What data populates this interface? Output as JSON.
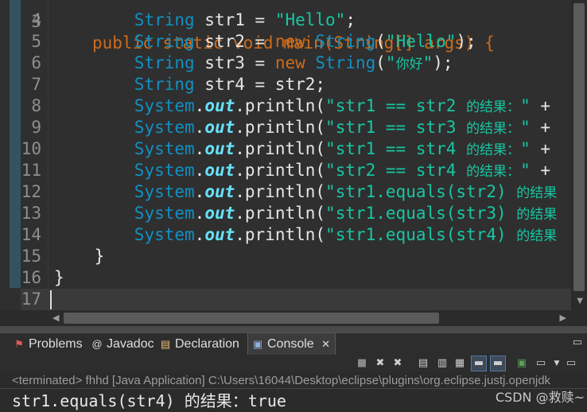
{
  "editor": {
    "header_line": {
      "num": "3",
      "text": "public static void main(String[] args) {"
    },
    "lines": [
      {
        "num": "4",
        "t": "String",
        "v": " str1 = ",
        "s": "\"Hello\"",
        "e": ";"
      },
      {
        "num": "5",
        "t": "String",
        "v": " str2 = ",
        "k": "new",
        "t2": " String",
        "p": "(",
        "s": "\"Hello\"",
        "e": ");"
      },
      {
        "num": "6",
        "t": "String",
        "v": " str3 = ",
        "k": "new",
        "t2": " String",
        "p": "(",
        "s": "\"",
        "cjk": "你好",
        "s2": "\"",
        "e": ");"
      },
      {
        "num": "7",
        "t": "String",
        "v": " str4 = str2;"
      },
      {
        "num": "8",
        "sys": "System",
        "dot": ".",
        "out": "out",
        "pr": ".println(",
        "s": "\"str1 == str2 ",
        "cjk": "的结果：",
        "s2": "\"",
        "e": " +"
      },
      {
        "num": "9",
        "sys": "System",
        "dot": ".",
        "out": "out",
        "pr": ".println(",
        "s": "\"str1 == str3 ",
        "cjk": "的结果：",
        "s2": "\"",
        "e": " +"
      },
      {
        "num": "10",
        "sys": "System",
        "dot": ".",
        "out": "out",
        "pr": ".println(",
        "s": "\"str1 == str4 ",
        "cjk": "的结果：",
        "s2": "\"",
        "e": " +"
      },
      {
        "num": "11",
        "sys": "System",
        "dot": ".",
        "out": "out",
        "pr": ".println(",
        "s": "\"str2 == str4 ",
        "cjk": "的结果：",
        "s2": "\"",
        "e": " +"
      },
      {
        "num": "12",
        "sys": "System",
        "dot": ".",
        "out": "out",
        "pr": ".println(",
        "s": "\"str1.equals(str2) ",
        "cjk": "的结果"
      },
      {
        "num": "13",
        "sys": "System",
        "dot": ".",
        "out": "out",
        "pr": ".println(",
        "s": "\"str1.equals(str3) ",
        "cjk": "的结果"
      },
      {
        "num": "14",
        "sys": "System",
        "dot": ".",
        "out": "out",
        "pr": ".println(",
        "s": "\"str1.equals(str4) ",
        "cjk": "的结果"
      },
      {
        "num": "15",
        "v": "    }"
      },
      {
        "num": "16",
        "v": "}"
      },
      {
        "num": "17",
        "v": ""
      }
    ]
  },
  "views": {
    "tabs": [
      {
        "label": "Problems",
        "icon": "problems-icon",
        "glyph": "⚑"
      },
      {
        "label": "Javadoc",
        "icon": "javadoc-icon",
        "glyph": "@"
      },
      {
        "label": "Declaration",
        "icon": "declaration-icon",
        "glyph": "▤"
      },
      {
        "label": "Console",
        "icon": "console-icon",
        "glyph": "▣"
      }
    ],
    "close_glyph": "✕"
  },
  "console": {
    "status": "<terminated> fhhd [Java Application] C:\\Users\\16044\\Desktop\\eclipse\\plugins\\org.eclipse.justj.openjdk",
    "output": "str1.equals(str4) 的结果：true"
  },
  "watermark": "CSDN @救赎~",
  "colors": {
    "keyword": "#cc6c1d",
    "type": "#1290c3",
    "string": "#17c6a3",
    "field": "#66e1f8",
    "line_number": "#8e8e8e",
    "background": "#2f2f2f"
  }
}
